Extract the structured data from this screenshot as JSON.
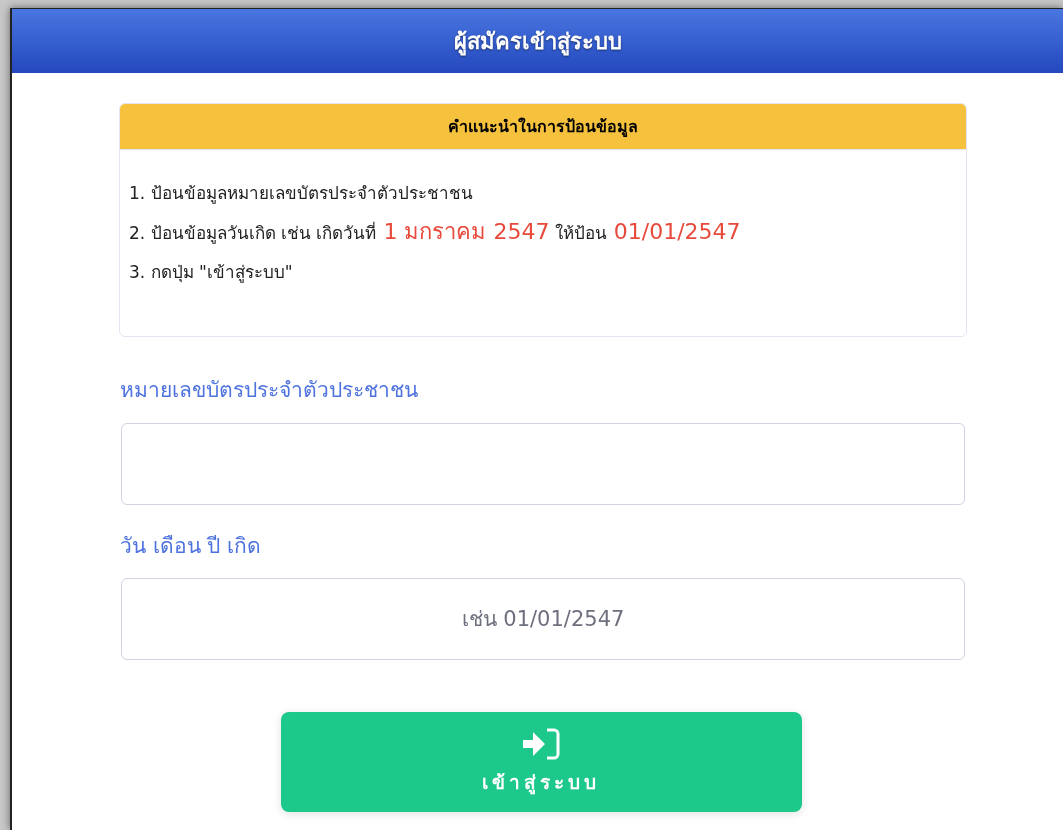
{
  "header": {
    "title": "ผู้สมัครเข้าสู่ระบบ"
  },
  "instructions": {
    "title": "คำแนะนำในการป้อนข้อมูล",
    "items": [
      [
        {
          "kind": "plain",
          "text": "1. ป้อนข้อมูลหมายเลขบัตรประจำตัวประชาชน"
        }
      ],
      [
        {
          "kind": "plain",
          "text": "2. ป้อนข้อมูลวันเกิด เช่น เกิดวันที่"
        },
        {
          "kind": "highlight",
          "text": "1 มกราคม 2547"
        },
        {
          "kind": "plain",
          "text": "ให้ป้อน"
        },
        {
          "kind": "highlight",
          "text": "01/01/2547"
        }
      ],
      [
        {
          "kind": "plain",
          "text": "3. กดปุ่ม \"เข้าสู่ระบบ\""
        }
      ]
    ]
  },
  "fields": [
    {
      "label": "หมายเลขบัตรประจำตัวประชาชน"
    },
    {
      "label": "วัน เดือน ปี เกิด",
      "placeholder": "เช่น 01/01/2547"
    }
  ],
  "submit_button": {
    "label": "เข้าสู่ระบบ"
  }
}
